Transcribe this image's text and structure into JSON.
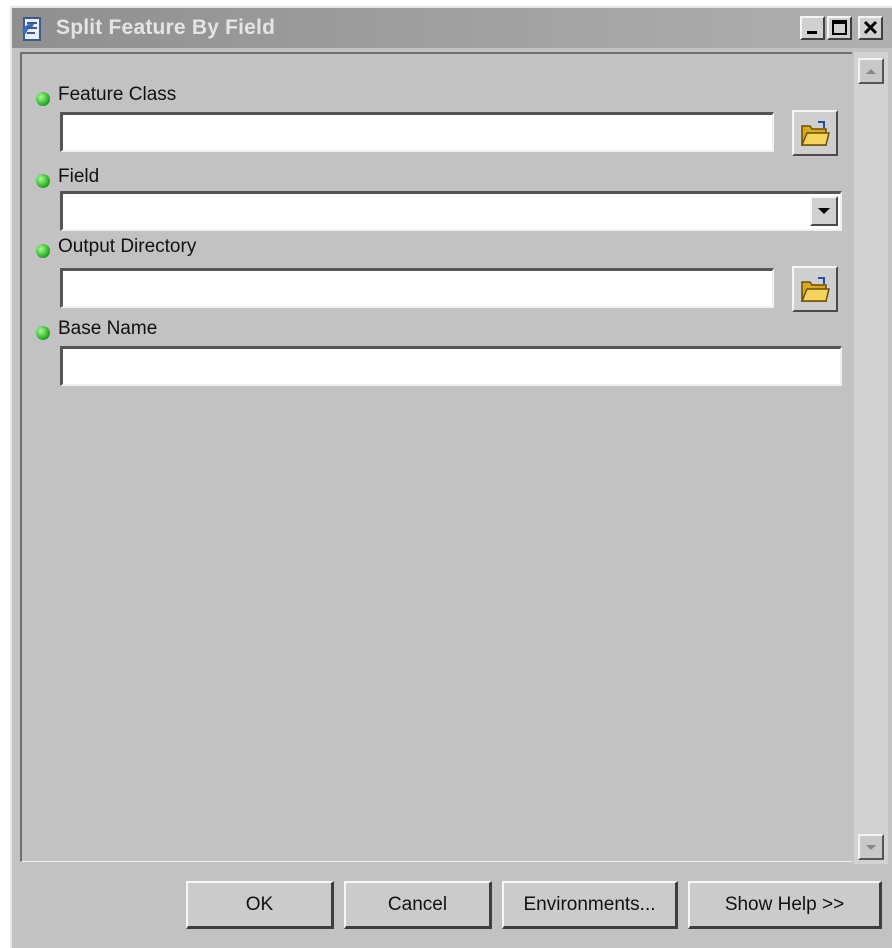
{
  "window": {
    "title": "Split Feature By Field"
  },
  "params": [
    {
      "label": "Feature Class",
      "value": "",
      "required": true,
      "control": "text-with-browse"
    },
    {
      "label": "Field",
      "value": "",
      "required": true,
      "control": "dropdown"
    },
    {
      "label": "Output Directory",
      "value": "",
      "required": true,
      "control": "text-with-browse"
    },
    {
      "label": "Base Name",
      "value": "",
      "required": true,
      "control": "text"
    }
  ],
  "footer": {
    "ok_label": "OK",
    "cancel_label": "Cancel",
    "environments_label": "Environments...",
    "help_label": "Show Help >>"
  },
  "icons": {
    "title": "toolbox-script-icon",
    "browse": "open-folder-icon",
    "required": "green-dot-icon",
    "dropdown": "chevron-down-icon"
  },
  "colors": {
    "window_bg": "#c2c2c2",
    "titlebar": "#9a9a9a",
    "required_dot": "#1ea31e"
  }
}
